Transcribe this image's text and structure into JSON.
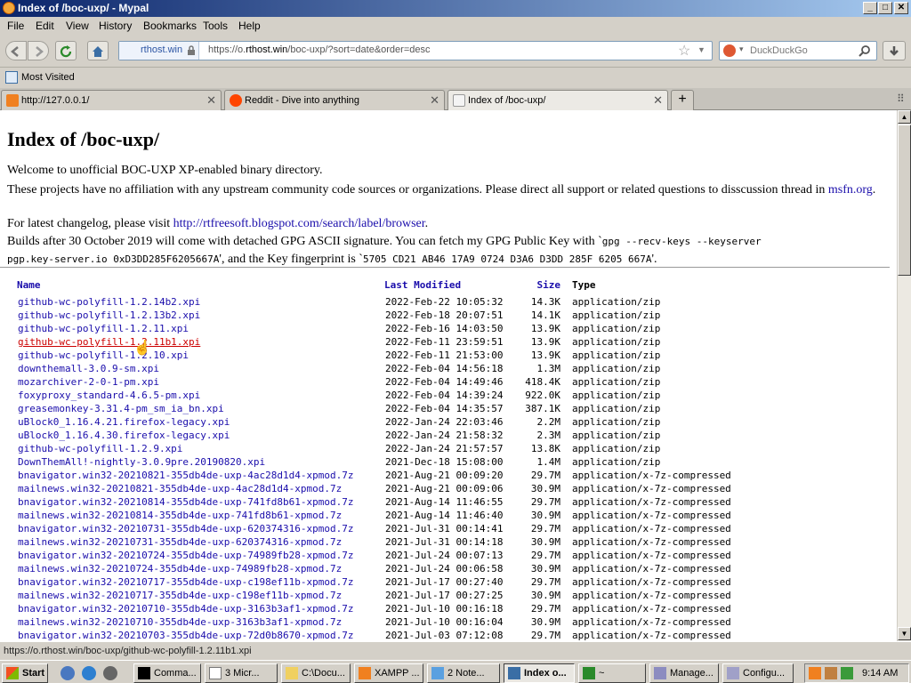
{
  "window": {
    "title": "Index of /boc-uxp/ - Mypal",
    "min": "_",
    "max": "□",
    "close": "✕"
  },
  "menu": [
    "File",
    "Edit",
    "View",
    "History",
    "Bookmarks",
    "Tools",
    "Help"
  ],
  "nav": {
    "identity": "rthost.win",
    "url_prefix": "https://o.",
    "url_domain": "rthost.win",
    "url_path": "/boc-uxp/?sort=date&order=desc",
    "search_placeholder": "DuckDuckGo"
  },
  "bookmarks": {
    "most_visited": "Most Visited"
  },
  "tabs": [
    {
      "label": "http://127.0.0.1/",
      "close": "✕"
    },
    {
      "label": "Reddit - Dive into anything",
      "close": "✕"
    },
    {
      "label": "Index of /boc-uxp/",
      "close": "✕"
    }
  ],
  "newtab": "+",
  "page": {
    "title": "Index of /boc-uxp/",
    "line1": "Welcome to unofficial BOC-UXP XP-enabled binary directory.",
    "line2a": "These projects have no affiliation with any upstream community code sources or organizations. Please direct all support or related questions to disscussion thread in",
    "line2b": "msfn.org",
    "line2c": ".",
    "line3a": "For latest changelog, please visit ",
    "line3b": "http://rtfreesoft.blogspot.com/search/label/browser",
    "line3c": ".",
    "line4a": "Builds after 30 October 2019 will come with detached GPG ASCII signature. You can fetch my GPG Public Key with `",
    "line4b": "gpg --recv-keys --keyserver",
    "line5a": "pgp.key-server.io 0xD3DD285F6205667A",
    "line5b": "', and the Key fingerprint is `",
    "line5c": "5705 CD21 AB46 17A9 0724 D3A6 D3DD 285F 6205 667A",
    "line5d": "'."
  },
  "columns": {
    "name": "Name",
    "modified": "Last Modified",
    "size": "Size",
    "type": "Type"
  },
  "files": [
    {
      "name": "github-wc-polyfill-1.2.14b2.xpi",
      "date": "2022-Feb-22 10:05:32",
      "size": "14.3K",
      "type": "application/zip"
    },
    {
      "name": "github-wc-polyfill-1.2.13b2.xpi",
      "date": "2022-Feb-18 20:07:51",
      "size": "14.1K",
      "type": "application/zip"
    },
    {
      "name": "github-wc-polyfill-1.2.11.xpi",
      "date": "2022-Feb-16 14:03:50",
      "size": "13.9K",
      "type": "application/zip"
    },
    {
      "name": "github-wc-polyfill-1.2.11b1.xpi",
      "date": "2022-Feb-11 23:59:51",
      "size": "13.9K",
      "type": "application/zip"
    },
    {
      "name": "github-wc-polyfill-1.2.10.xpi",
      "date": "2022-Feb-11 21:53:00",
      "size": "13.9K",
      "type": "application/zip"
    },
    {
      "name": "downthemall-3.0.9-sm.xpi",
      "date": "2022-Feb-04 14:56:18",
      "size": "1.3M",
      "type": "application/zip"
    },
    {
      "name": "mozarchiver-2-0-1-pm.xpi",
      "date": "2022-Feb-04 14:49:46",
      "size": "418.4K",
      "type": "application/zip"
    },
    {
      "name": "foxyproxy_standard-4.6.5-pm.xpi",
      "date": "2022-Feb-04 14:39:24",
      "size": "922.0K",
      "type": "application/zip"
    },
    {
      "name": "greasemonkey-3.31.4-pm_sm_ia_bn.xpi",
      "date": "2022-Feb-04 14:35:57",
      "size": "387.1K",
      "type": "application/zip"
    },
    {
      "name": "uBlock0_1.16.4.21.firefox-legacy.xpi",
      "date": "2022-Jan-24 22:03:46",
      "size": "2.2M",
      "type": "application/zip"
    },
    {
      "name": "uBlock0_1.16.4.30.firefox-legacy.xpi",
      "date": "2022-Jan-24 21:58:32",
      "size": "2.3M",
      "type": "application/zip"
    },
    {
      "name": "github-wc-polyfill-1.2.9.xpi",
      "date": "2022-Jan-24 21:57:57",
      "size": "13.8K",
      "type": "application/zip"
    },
    {
      "name": "DownThemAll!-nightly-3.0.9pre.20190820.xpi",
      "date": "2021-Dec-18 15:08:00",
      "size": "1.4M",
      "type": "application/zip"
    },
    {
      "name": "bnavigator.win32-20210821-355db4de-uxp-4ac28d1d4-xpmod.7z",
      "date": "2021-Aug-21 00:09:20",
      "size": "29.7M",
      "type": "application/x-7z-compressed"
    },
    {
      "name": "mailnews.win32-20210821-355db4de-uxp-4ac28d1d4-xpmod.7z",
      "date": "2021-Aug-21 00:09:06",
      "size": "30.9M",
      "type": "application/x-7z-compressed"
    },
    {
      "name": "bnavigator.win32-20210814-355db4de-uxp-741fd8b61-xpmod.7z",
      "date": "2021-Aug-14 11:46:55",
      "size": "29.7M",
      "type": "application/x-7z-compressed"
    },
    {
      "name": "mailnews.win32-20210814-355db4de-uxp-741fd8b61-xpmod.7z",
      "date": "2021-Aug-14 11:46:40",
      "size": "30.9M",
      "type": "application/x-7z-compressed"
    },
    {
      "name": "bnavigator.win32-20210731-355db4de-uxp-620374316-xpmod.7z",
      "date": "2021-Jul-31 00:14:41",
      "size": "29.7M",
      "type": "application/x-7z-compressed"
    },
    {
      "name": "mailnews.win32-20210731-355db4de-uxp-620374316-xpmod.7z",
      "date": "2021-Jul-31 00:14:18",
      "size": "30.9M",
      "type": "application/x-7z-compressed"
    },
    {
      "name": "bnavigator.win32-20210724-355db4de-uxp-74989fb28-xpmod.7z",
      "date": "2021-Jul-24 00:07:13",
      "size": "29.7M",
      "type": "application/x-7z-compressed"
    },
    {
      "name": "mailnews.win32-20210724-355db4de-uxp-74989fb28-xpmod.7z",
      "date": "2021-Jul-24 00:06:58",
      "size": "30.9M",
      "type": "application/x-7z-compressed"
    },
    {
      "name": "bnavigator.win32-20210717-355db4de-uxp-c198ef11b-xpmod.7z",
      "date": "2021-Jul-17 00:27:40",
      "size": "29.7M",
      "type": "application/x-7z-compressed"
    },
    {
      "name": "mailnews.win32-20210717-355db4de-uxp-c198ef11b-xpmod.7z",
      "date": "2021-Jul-17 00:27:25",
      "size": "30.9M",
      "type": "application/x-7z-compressed"
    },
    {
      "name": "bnavigator.win32-20210710-355db4de-uxp-3163b3af1-xpmod.7z",
      "date": "2021-Jul-10 00:16:18",
      "size": "29.7M",
      "type": "application/x-7z-compressed"
    },
    {
      "name": "mailnews.win32-20210710-355db4de-uxp-3163b3af1-xpmod.7z",
      "date": "2021-Jul-10 00:16:04",
      "size": "30.9M",
      "type": "application/x-7z-compressed"
    },
    {
      "name": "bnavigator.win32-20210703-355db4de-uxp-72d0b8670-xpmod.7z",
      "date": "2021-Jul-03 07:12:08",
      "size": "29.7M",
      "type": "application/x-7z-compressed"
    }
  ],
  "hover_row": 3,
  "status": "https://o.rthost.win/boc-uxp/github-wc-polyfill-1.2.11b1.xpi",
  "taskbar": {
    "start": "Start",
    "tasks": [
      "Comma...",
      "3 Micr...",
      "C:\\Docu...",
      "XAMPP ...",
      "2 Note...",
      "Index o...",
      "~",
      "Manage...",
      "Configu..."
    ],
    "clock": "9:14 AM"
  }
}
